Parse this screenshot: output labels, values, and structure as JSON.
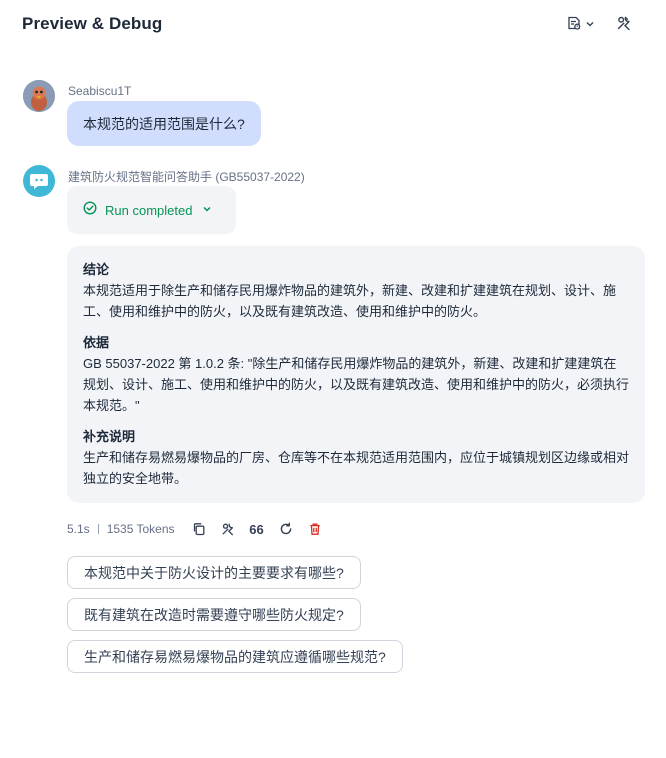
{
  "header": {
    "title": "Preview & Debug",
    "variables_icon": "file-variables-icon",
    "tools_icon": "wrench-icon"
  },
  "user_message": {
    "sender": "Seabiscu1T",
    "text": "本规范的适用范围是什么?"
  },
  "bot_message": {
    "sender": "建筑防火规范智能问答助手 (GB55037-2022)",
    "run_status": "Run completed",
    "sections": [
      {
        "heading": "结论",
        "body": "本规范适用于除生产和储存民用爆炸物品的建筑外，新建、改建和扩建建筑在规划、设计、施工、使用和维护中的防火，以及既有建筑改造、使用和维护中的防火。"
      },
      {
        "heading": "依据",
        "body": "GB 55037-2022 第 1.0.2 条: \"除生产和储存民用爆炸物品的建筑外，新建、改建和扩建建筑在规划、设计、施工、使用和维护中的防火，以及既有建筑改造、使用和维护中的防火，必须执行本规范。\""
      },
      {
        "heading": "补充说明",
        "body": "生产和储存易燃易爆物品的厂房、仓库等不在本规范适用范围内，应位于城镇规划区边缘或相对独立的安全地带。"
      }
    ],
    "meta": {
      "latency": "5.1s",
      "tokens": "1535 Tokens",
      "quote_label": "66"
    }
  },
  "suggestions": [
    "本规范中关于防火设计的主要要求有哪些?",
    "既有建筑在改造时需要遵守哪些防火规定?",
    "生产和储存易燃易爆物品的建筑应遵循哪些规范?"
  ],
  "colors": {
    "user_bubble": "#d1ddfd",
    "bot_bubble": "#f2f4f7",
    "success": "#079455",
    "danger": "#d92d20"
  }
}
